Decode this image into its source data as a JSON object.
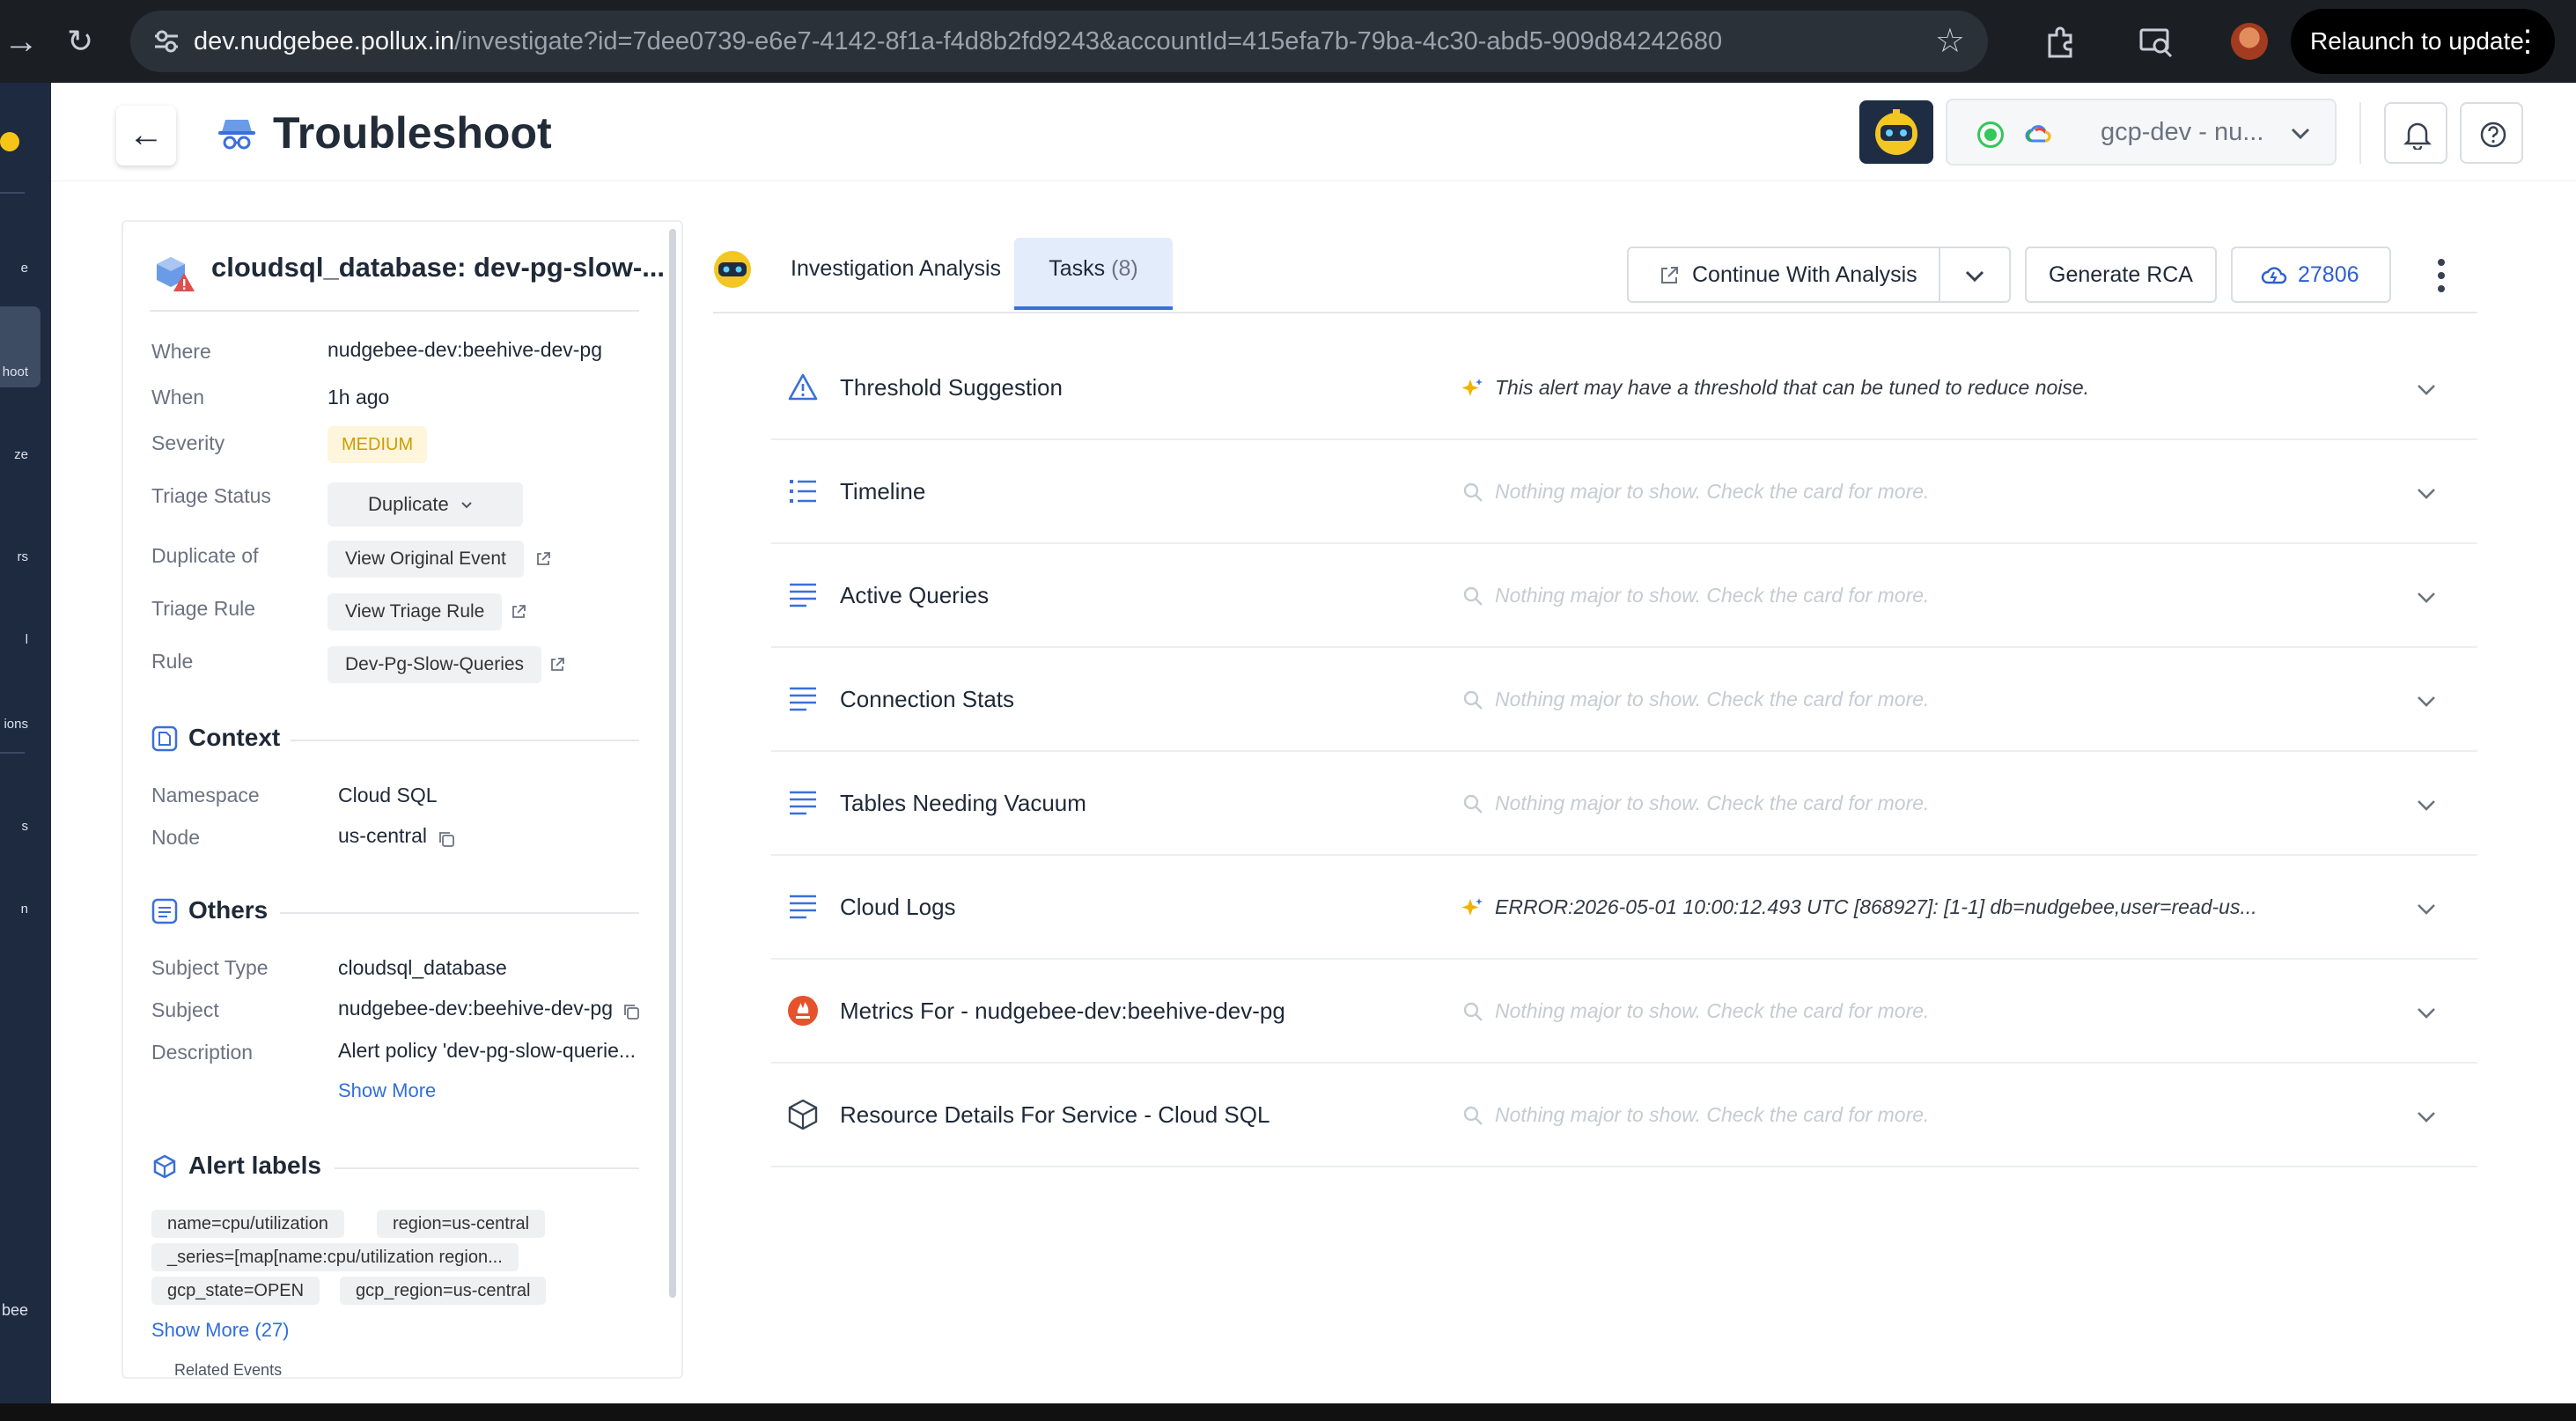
{
  "browser": {
    "url_host": "dev.nudgebee.pollux.in",
    "url_path": "/investigate?id=7dee0739-e6e7-4142-8f1a-f4d8b2fd9243&accountId=415efa7b-79ba-4c30-abd5-909d84242680",
    "relaunch_label": "Relaunch to update"
  },
  "rail": {
    "labels": [
      "e",
      "hoot",
      "ze",
      "rs",
      "l",
      "ions",
      "s",
      "n",
      "bee"
    ]
  },
  "header": {
    "title": "Troubleshoot",
    "account": "gcp-dev - nu..."
  },
  "details": {
    "resource_title": "cloudsql_database: dev-pg-slow-...",
    "where_label": "Where",
    "where_value": "nudgebee-dev:beehive-dev-pg",
    "when_label": "When",
    "when_value": "1h ago",
    "severity_label": "Severity",
    "severity_value": "MEDIUM",
    "triage_status_label": "Triage Status",
    "triage_status_value": "Duplicate",
    "duplicate_of_label": "Duplicate of",
    "duplicate_of_value": "View Original Event",
    "triage_rule_label": "Triage Rule",
    "triage_rule_value": "View Triage Rule",
    "rule_label": "Rule",
    "rule_value": "Dev-Pg-Slow-Queries"
  },
  "context": {
    "title": "Context",
    "namespace_label": "Namespace",
    "namespace_value": "Cloud SQL",
    "node_label": "Node",
    "node_value": "us-central"
  },
  "others": {
    "title": "Others",
    "subject_type_label": "Subject Type",
    "subject_type_value": "cloudsql_database",
    "subject_label": "Subject",
    "subject_value": "nudgebee-dev:beehive-dev-pg",
    "description_label": "Description",
    "description_value": "Alert policy 'dev-pg-slow-querie...",
    "show_more": "Show More"
  },
  "alert_labels": {
    "title": "Alert labels",
    "tags": [
      "name=cpu/utilization",
      "region=us-central",
      "_series=[map[name:cpu/utilization region...",
      "gcp_state=OPEN",
      "gcp_region=us-central"
    ],
    "show_more": "Show More (27)",
    "related_events": "Related Events"
  },
  "tabs": {
    "investigation": "Investigation Analysis",
    "tasks": "Tasks",
    "tasks_count": "(8)"
  },
  "toolbar": {
    "continue": "Continue With Analysis",
    "generate_rca": "Generate RCA",
    "credits": "27806"
  },
  "colors": {
    "accent": "#3b6fd9",
    "rail_bg": "#1e2a3f",
    "severity_medium": "#d09a00",
    "sparkle": "#f0b400"
  },
  "tasks": [
    {
      "title": "Threshold Suggestion",
      "summary": "This alert may have a threshold that can be tuned to reduce noise.",
      "icon": "warning-icon",
      "summary_icon": "sparkle-icon"
    },
    {
      "title": "Timeline",
      "summary": "Nothing major to show. Check the card for more.",
      "icon": "list-icon",
      "summary_icon": "search-icon"
    },
    {
      "title": "Active Queries",
      "summary": "Nothing major to show. Check the card for more.",
      "icon": "lines-icon",
      "summary_icon": "search-icon"
    },
    {
      "title": "Connection Stats",
      "summary": "Nothing major to show. Check the card for more.",
      "icon": "lines-icon",
      "summary_icon": "search-icon"
    },
    {
      "title": "Tables Needing Vacuum",
      "summary": "Nothing major to show. Check the card for more.",
      "icon": "lines-icon",
      "summary_icon": "search-icon"
    },
    {
      "title": "Cloud Logs",
      "summary": "ERROR:2026-05-01 10:00:12.493 UTC [868927]: [1-1] db=nudgebee,user=read-us...",
      "icon": "lines-icon",
      "summary_icon": "sparkle-icon"
    },
    {
      "title": "Metrics For - nudgebee-dev:beehive-dev-pg",
      "summary": "Nothing major to show. Check the card for more.",
      "icon": "prometheus-icon",
      "summary_icon": "search-icon"
    },
    {
      "title": "Resource Details For Service - Cloud SQL",
      "summary": "Nothing major to show. Check the card for more.",
      "icon": "cube-icon",
      "summary_icon": "search-icon"
    }
  ]
}
